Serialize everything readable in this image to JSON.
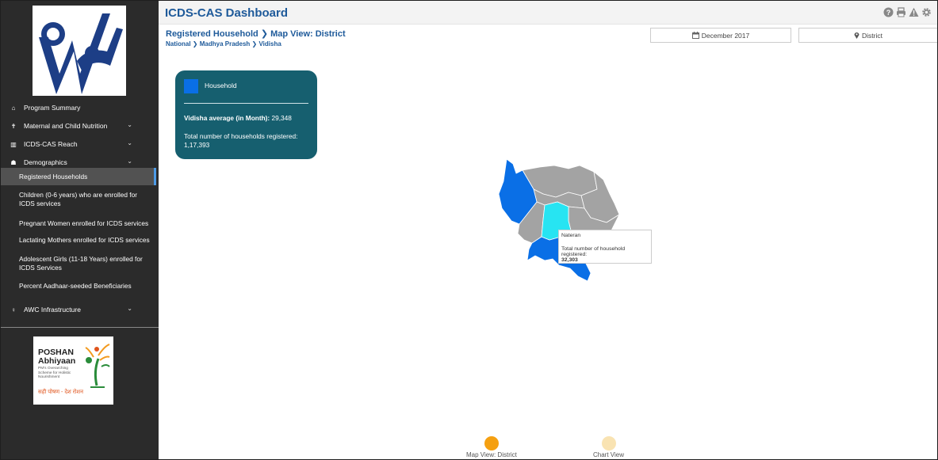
{
  "app": {
    "title": "ICDS-CAS Dashboard"
  },
  "header_icons": [
    "help-icon",
    "print-icon",
    "warning-icon",
    "settings-icon"
  ],
  "sidebar": {
    "items": [
      {
        "icon": "home-icon",
        "label": "Program Summary",
        "expandable": false
      },
      {
        "icon": "child-icon",
        "label": "Maternal and Child Nutrition",
        "expandable": true
      },
      {
        "icon": "bar-chart-icon",
        "label": "ICDS-CAS Reach",
        "expandable": true
      },
      {
        "icon": "people-icon",
        "label": "Demographics",
        "expandable": true
      }
    ],
    "demographics_sub": [
      "Registered Households",
      "Children (0-6 years) who are enrolled for ICDS services",
      "Pregnant Women enrolled for ICDS services",
      "Lactating Mothers enrolled for ICDS services",
      "Adolescent Girls (11-18 Years) enrolled for ICDS Services",
      "Percent Aadhaar-seeded Beneficiaries"
    ],
    "awc": {
      "icon": "location-icon",
      "label": "AWC Infrastructure"
    },
    "poshan": {
      "title1": "POSHAN",
      "title2": "Abhiyaan",
      "tagline": "PM's Overarching Scheme for Holistic Nourishment",
      "hindi": "सही पोषण - देश रोशन"
    }
  },
  "page": {
    "title": "Registered Household",
    "chevron": "❯",
    "view": "Map View: District",
    "breadcrumb": [
      "National",
      "Madhya Pradesh",
      "Vidisha"
    ]
  },
  "filters": {
    "date": "December 2017",
    "level": "District"
  },
  "info_card": {
    "legend_label": "Household",
    "avg_label": "Vidisha average (in Month):",
    "avg_value": "29,348",
    "total_label": "Total number of households registered:",
    "total_value": "1,17,393"
  },
  "tooltip": {
    "name": "Nateran",
    "label": "Total number of household registered:",
    "value": "32,303"
  },
  "views": {
    "map": "Map View: District",
    "chart": "Chart View"
  },
  "colors": {
    "brand": "#1e5a9a",
    "card": "#165f6f",
    "highlight": "#0a6fe6",
    "hover": "#27e4f2",
    "other": "#a3a3a3",
    "active_view": "#f5a011",
    "inactive_view": "#f9e3b2"
  }
}
